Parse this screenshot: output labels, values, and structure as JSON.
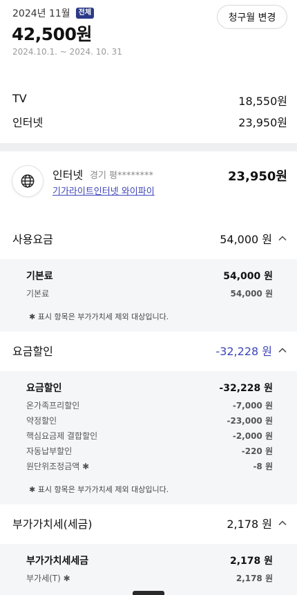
{
  "header": {
    "period": "2024년 11월",
    "badge": "전체",
    "change_button": "청구월 변경",
    "total": "42,500원",
    "date_range": "2024.10.1. ~ 2024. 10. 31"
  },
  "summary": [
    {
      "label": "TV",
      "amount": "18,550원"
    },
    {
      "label": "인터넷",
      "amount": "23,950원"
    }
  ],
  "service": {
    "icon": "globe-icon",
    "name": "인터넷",
    "location": "경기 평********",
    "product": "기가라이트인터넷 와이파이",
    "amount": "23,950원"
  },
  "sections": {
    "usage": {
      "title": "사용요금",
      "amount": "54,000 원",
      "main_label": "기본료",
      "main_value": "54,000 원",
      "items": [
        {
          "label": "기본료",
          "value": "54,000 원"
        }
      ],
      "note": "✱  표시 항목은 부가가치세 제외 대상입니다."
    },
    "discount": {
      "title": "요금할인",
      "amount": "-32,228 원",
      "main_label": "요금할인",
      "main_value": "-32,228 원",
      "items": [
        {
          "label": "온가족프리할인",
          "value": "-7,000 원"
        },
        {
          "label": "약정할인",
          "value": "-23,000 원"
        },
        {
          "label": "핵심요금제 결합할인",
          "value": "-2,000 원"
        },
        {
          "label": "자동납부할인",
          "value": "-220 원"
        },
        {
          "label": "원단위조정금액  ✱",
          "value": "-8 원"
        }
      ],
      "note": "✱  표시 항목은 부가가치세 제외 대상입니다."
    },
    "vat": {
      "title": "부가가치세(세금)",
      "amount": "2,178 원",
      "main_label": "부가가치세세금",
      "main_value": "2,178 원",
      "items": [
        {
          "label": "부가세(T)  ✱",
          "value": "2,178 원"
        }
      ]
    }
  },
  "colors": {
    "accent": "#3d44b8",
    "badge": "#2b3a87",
    "section_bg": "#f5f6f8"
  }
}
